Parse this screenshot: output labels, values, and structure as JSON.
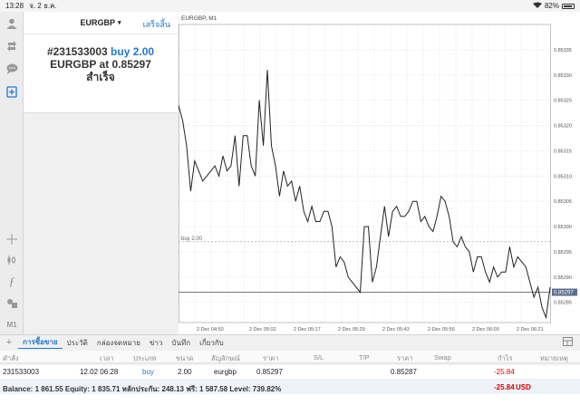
{
  "status_bar": {
    "time": "13:28",
    "date": "จ. 2 ธ.ค.",
    "battery": "82%"
  },
  "sidebar_icons": [
    "person-icon",
    "trade-icon",
    "chat-icon",
    "new-order-icon",
    "crosshair-icon",
    "indicators-icon",
    "function-icon",
    "objects-icon",
    "timeframe-label"
  ],
  "sidebar_timeframe": "M1",
  "order_panel": {
    "symbol": "EURGBP",
    "dropdown_arrow": "▾",
    "done_label": "เสร็จสิ้น",
    "order_number": "#231533003",
    "order_action": "buy 2.00",
    "order_line2_prefix": "EURGBP at ",
    "order_price": "0.85297",
    "order_status": "สำเร็จ"
  },
  "chart": {
    "label": "EURGBP, M1",
    "order_line_label": "buy 2.00",
    "bid_badge": "0.85297",
    "price_ticks": [
      "0.85335",
      "0.85330",
      "0.85325",
      "0.85320",
      "0.85315",
      "0.85310",
      "0.85305",
      "0.85300",
      "0.85295",
      "0.85290",
      "0.85285"
    ],
    "time_ticks": [
      "2 Dec 04:50",
      "2 Dec 05:02",
      "2 Dec 05:17",
      "2 Dec 05:29",
      "2 Dec 05:43",
      "2 Dec 05:56",
      "2 Dec 06:09",
      "2 Dec 06:21"
    ]
  },
  "chart_data": {
    "type": "line",
    "title": "EURGBP, M1",
    "y_range": [
      0.85281,
      0.8534
    ],
    "order_line_price": 0.85297,
    "bid_line_price": 0.85287,
    "series": [
      {
        "values": [
          0.85324,
          0.85321,
          0.85316,
          0.85307,
          0.85313,
          0.85311,
          0.85309,
          0.8531,
          0.85311,
          0.85312,
          0.8531,
          0.85314,
          0.85311,
          0.85312,
          0.85318,
          0.85308,
          0.85318,
          0.85318,
          0.85312,
          0.8531,
          0.85325,
          0.85316,
          0.85331,
          0.85316,
          0.85312,
          0.85306,
          0.85311,
          0.85308,
          0.85309,
          0.85305,
          0.85308,
          0.85303,
          0.85301,
          0.85304,
          0.85301,
          0.85301,
          0.85303,
          0.85303,
          0.853,
          0.85292,
          0.85294,
          0.85293,
          0.8529,
          0.85289,
          0.85288,
          0.85287,
          0.853,
          0.853,
          0.85289,
          0.85292,
          0.85298,
          0.85304,
          0.85298,
          0.85303,
          0.85304,
          0.85302,
          0.85302,
          0.85303,
          0.85305,
          0.85305,
          0.85301,
          0.85302,
          0.853,
          0.85299,
          0.85302,
          0.85306,
          0.85305,
          0.85302,
          0.85297,
          0.85296,
          0.85298,
          0.85296,
          0.85295,
          0.85291,
          0.85294,
          0.85294,
          0.85291,
          0.85289,
          0.85292,
          0.8529,
          0.85291,
          0.85291,
          0.85296,
          0.85292,
          0.85294,
          0.85293,
          0.85292,
          0.85289,
          0.85286,
          0.85288,
          0.85284,
          0.85282,
          0.85288
        ]
      }
    ]
  },
  "tabs": [
    "การซื้อขาย",
    "ประวัติ",
    "กล่องจดหมาย",
    "ข่าว",
    "บันทึก",
    "เกี่ยวกับ"
  ],
  "table": {
    "headers": {
      "order": "คำสั่ง",
      "time": "เวลา",
      "type": "ประเภท",
      "volume": "ขนาด",
      "symbol": "สัญลักษณ์",
      "price": "ราคา",
      "sl": "S/L",
      "tp": "T/P",
      "price2": "ราคา",
      "swap": "Swap",
      "profit": "กำไร",
      "comment": "หมายเหตุ"
    },
    "row": {
      "order": "231533003",
      "time": "12.02 06:28",
      "type": "buy",
      "volume": "2.00",
      "symbol": "eurgbp",
      "price": "0.85297",
      "price2": "0.85287",
      "profit": "-25.84"
    }
  },
  "balance": {
    "text": "Balance: 1 861.55 Equity: 1 835.71 หลักประกัน: 248.13 ฟรี: 1 587.58 Level: 739.82%",
    "profit": "-25.84",
    "currency": "USD"
  }
}
